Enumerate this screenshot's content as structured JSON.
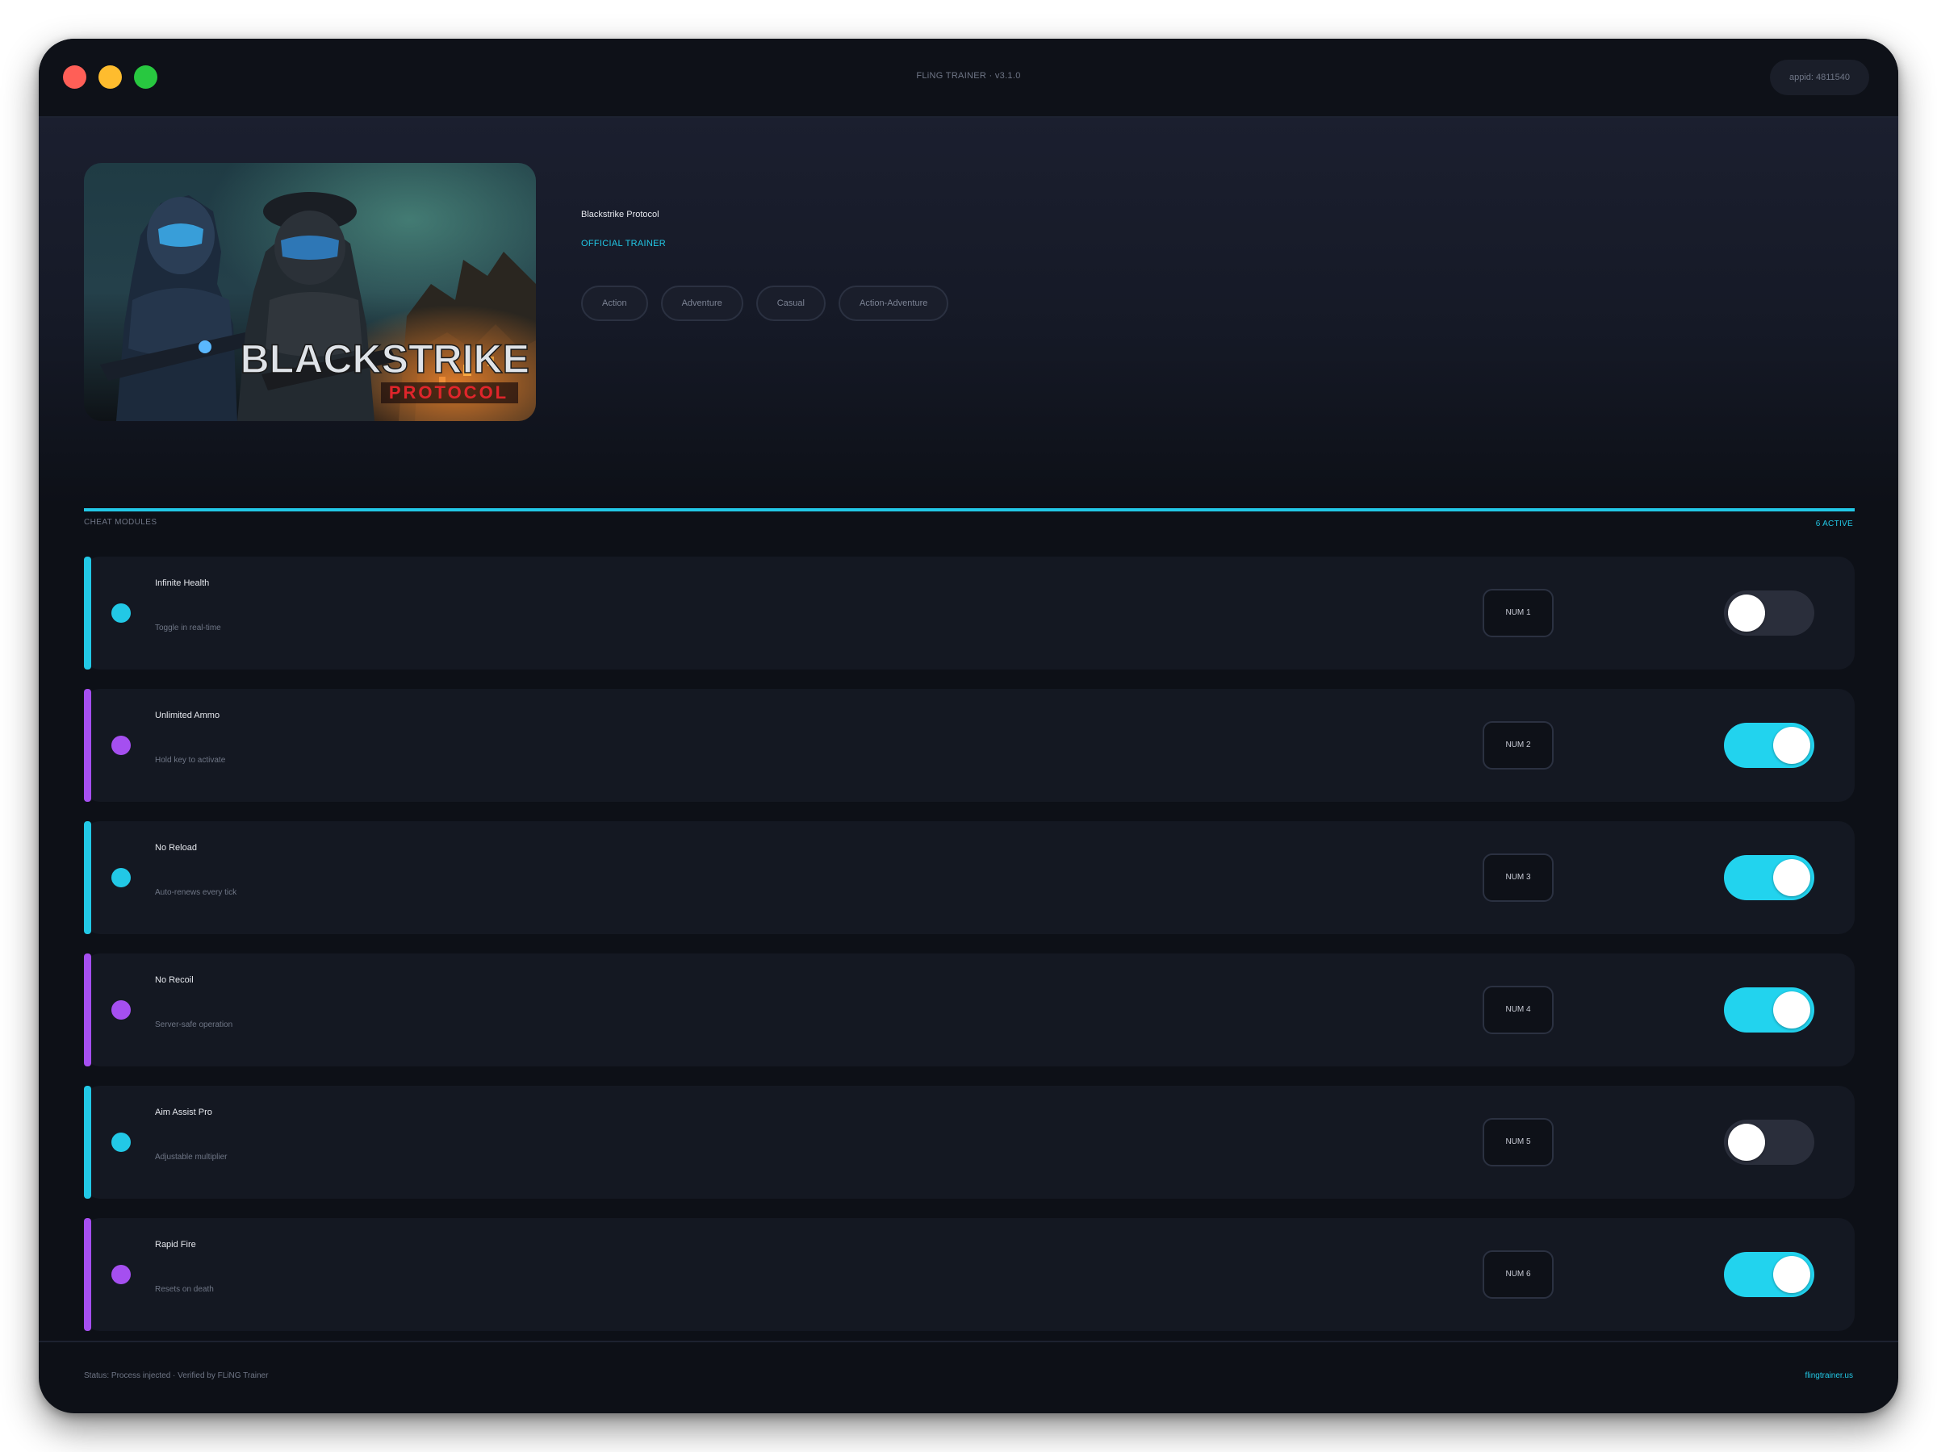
{
  "window": {
    "title": "FLiNG TRAINER · v3.1.0",
    "appid": "appid: 4811540"
  },
  "game": {
    "title": "Blackstrike Protocol",
    "badge": "OFFICIAL TRAINER",
    "cover": {
      "logo_line1": "BLACKSTRIKE",
      "logo_line2": "PROTOCOL"
    },
    "tags": [
      "Action",
      "Adventure",
      "Casual",
      "Action-Adventure"
    ]
  },
  "modules_header": {
    "label": "CHEAT MODULES",
    "active": "6 ACTIVE"
  },
  "colors": {
    "cyan": "#22c8e6",
    "purple": "#a54ff0",
    "toggle_on": "#22d3ee",
    "toggle_off": "#2a2e3b"
  },
  "modules": [
    {
      "name": "Infinite Health",
      "desc": "Toggle in real-time",
      "hotkey": "NUM 1",
      "accent": "cyan",
      "enabled": false
    },
    {
      "name": "Unlimited Ammo",
      "desc": "Hold key to activate",
      "hotkey": "NUM 2",
      "accent": "purple",
      "enabled": true
    },
    {
      "name": "No Reload",
      "desc": "Auto-renews every tick",
      "hotkey": "NUM 3",
      "accent": "cyan",
      "enabled": true
    },
    {
      "name": "No Recoil",
      "desc": "Server-safe operation",
      "hotkey": "NUM 4",
      "accent": "purple",
      "enabled": true
    },
    {
      "name": "Aim Assist Pro",
      "desc": "Adjustable multiplier",
      "hotkey": "NUM 5",
      "accent": "cyan",
      "enabled": false
    },
    {
      "name": "Rapid Fire",
      "desc": "Resets on death",
      "hotkey": "NUM 6",
      "accent": "purple",
      "enabled": true
    }
  ],
  "footer": {
    "status": "Status: Process injected · Verified by FLiNG Trainer",
    "site": "flingtrainer.us"
  }
}
